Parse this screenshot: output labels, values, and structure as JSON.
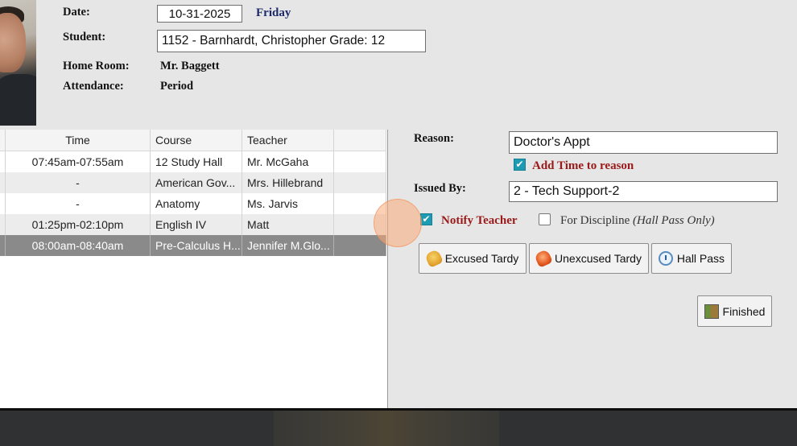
{
  "student_header": {
    "date_label": "Date:",
    "date_value": "10-31-2025",
    "day": "Friday",
    "student_label": "Student:",
    "student_value": "1152 - Barnhardt, Christopher Grade: 12",
    "homeroom_label": "Home Room:",
    "homeroom_value": "Mr. Baggett",
    "attendance_label": "Attendance:",
    "attendance_value": "Period"
  },
  "schedule": {
    "columns": [
      "Time",
      "Course",
      "Teacher"
    ],
    "rows": [
      {
        "time": "07:45am-07:55am",
        "course": "12 Study Hall",
        "teacher": "Mr. McGaha"
      },
      {
        "time": "-",
        "course": "American Gov...",
        "teacher": "Mrs. Hillebrand"
      },
      {
        "time": "-",
        "course": "Anatomy",
        "teacher": "Ms. Jarvis"
      },
      {
        "time": "01:25pm-02:10pm",
        "course": "English IV",
        "teacher": "Matt"
      },
      {
        "time": "08:00am-08:40am",
        "course": "Pre-Calculus H...",
        "teacher": "Jennifer M.Glo..."
      }
    ]
  },
  "form": {
    "reason_label": "Reason:",
    "reason_value": "Doctor's Appt",
    "add_time_label": "Add Time to reason",
    "issued_by_label": "Issued By:",
    "issued_by_value": "2 - Tech Support-2",
    "notify_teacher_label": "Notify Teacher",
    "for_discipline_label": "For Discipline",
    "for_discipline_note": "(Hall Pass Only)",
    "add_time_checked": true,
    "notify_teacher_checked": true,
    "for_discipline_checked": false
  },
  "buttons": {
    "excused_tardy": "Excused Tardy",
    "unexcused_tardy": "Unexcused Tardy",
    "hall_pass": "Hall Pass",
    "finished": "Finished"
  },
  "icons": {
    "excused": "bell-icon",
    "unexcused": "bell-red-icon",
    "hall_pass": "clock-icon",
    "finished": "door-exit-icon"
  },
  "colors": {
    "checkbox_accent": "#1d9bb3",
    "red_label": "#9a1a1a",
    "day_text": "#1c2a6b",
    "selected_row": "#8a8a8a"
  }
}
